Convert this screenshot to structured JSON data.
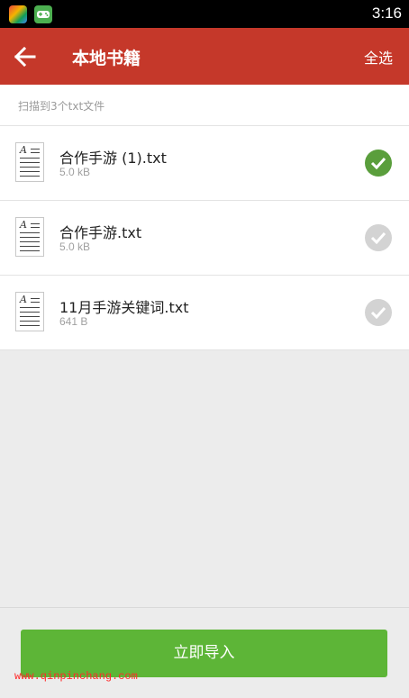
{
  "status_bar": {
    "time": "3:16"
  },
  "toolbar": {
    "title": "本地书籍",
    "select_all_label": "全选"
  },
  "info": {
    "scan_result": "扫描到3个txt文件"
  },
  "files": [
    {
      "name": "合作手游 (1).txt",
      "size": "5.0 kB",
      "checked": true
    },
    {
      "name": "合作手游.txt",
      "size": "5.0 kB",
      "checked": false
    },
    {
      "name": "11月手游关键词.txt",
      "size": "641 B",
      "checked": false
    }
  ],
  "bottom": {
    "import_label": "立即导入"
  },
  "watermark": {
    "text": "www.qinpinchang.com"
  },
  "colors": {
    "toolbar": "#c5382a",
    "checked": "#5a9e3c",
    "unchecked": "#d3d3d3",
    "import_button": "#5db537"
  }
}
